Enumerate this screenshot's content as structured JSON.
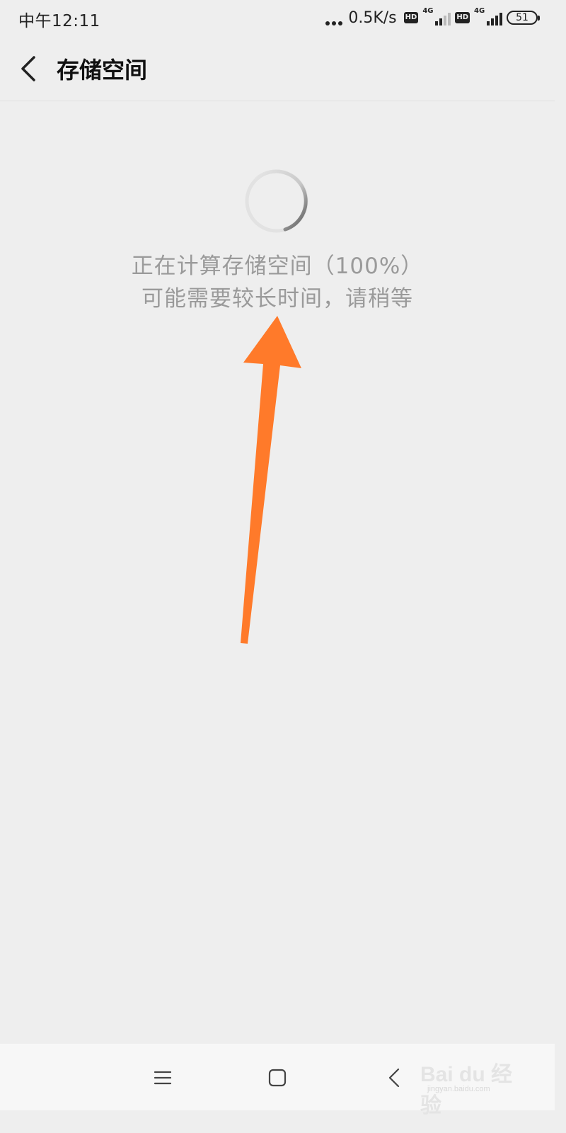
{
  "status_bar": {
    "time": "中午12:11",
    "net_speed": "0.5K/s",
    "hd_badge": "HD",
    "network_type": "4G",
    "battery": "51"
  },
  "header": {
    "title": "存储空间"
  },
  "loading": {
    "line1": "正在计算存储空间（100%）",
    "line2": "可能需要较长时间，请稍等",
    "progress_percent": 100
  },
  "nav_bar": {
    "items": [
      "menu-icon",
      "home-icon",
      "back-icon"
    ]
  },
  "watermark": {
    "main": "Bai du 经验",
    "sub": "jingyan.baidu.com"
  },
  "colors": {
    "background": "#eeeeee",
    "annotation_arrow": "#ff7a2a",
    "loading_text": "#9a9a9a"
  }
}
